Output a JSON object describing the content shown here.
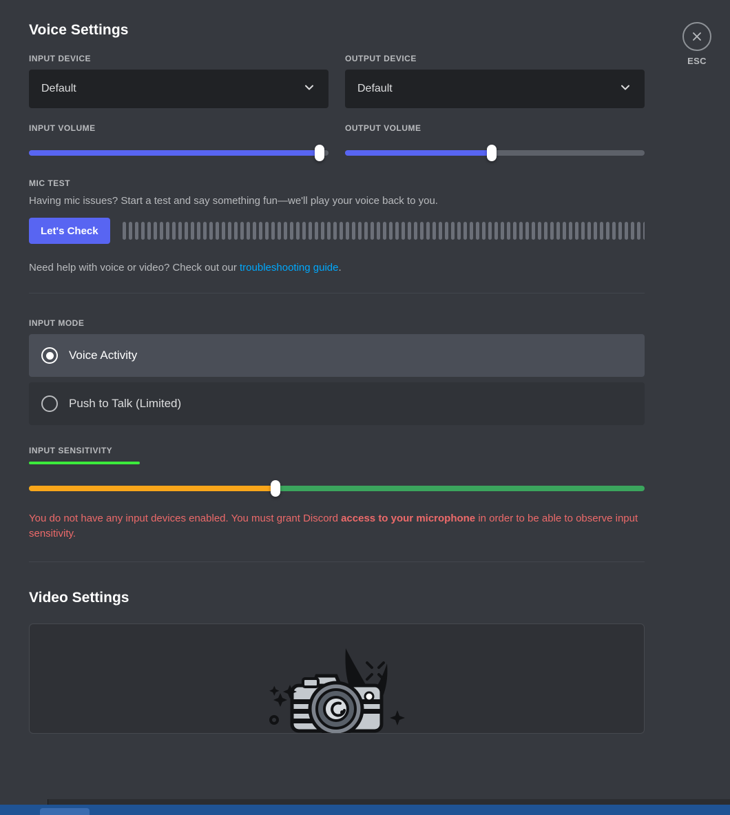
{
  "voice": {
    "title": "Voice Settings",
    "input_device": {
      "label": "INPUT DEVICE",
      "value": "Default",
      "chevron_icon": "chevron-down-icon"
    },
    "output_device": {
      "label": "OUTPUT DEVICE",
      "value": "Default",
      "chevron_icon": "chevron-down-icon"
    },
    "input_volume": {
      "label": "INPUT VOLUME",
      "percent": 97
    },
    "output_volume": {
      "label": "OUTPUT VOLUME",
      "percent": 49
    },
    "mic_test": {
      "label": "MIC TEST",
      "description": "Having mic issues? Start a test and say something fun—we'll play your voice back to you.",
      "button_label": "Let's Check",
      "bar_count": 85
    },
    "help": {
      "prefix": "Need help with voice or video? Check out our ",
      "link_text": "troubleshooting guide",
      "suffix": "."
    },
    "input_mode": {
      "label": "INPUT MODE",
      "options": [
        {
          "label": "Voice Activity",
          "selected": true
        },
        {
          "label": "Push to Talk (Limited)",
          "selected": false
        }
      ]
    },
    "input_sensitivity": {
      "label": "INPUT SENSITIVITY",
      "meter_percent": 18,
      "slider_percent": 40,
      "warning_prefix": "You do not have any input devices enabled. You must grant Discord ",
      "warning_bold": "access to your microphone",
      "warning_suffix": " in order to be able to observe input sensitivity."
    }
  },
  "video": {
    "title": "Video Settings",
    "preview_art_icon": "camera-illustration-icon"
  },
  "close": {
    "icon": "close-icon",
    "label": "ESC"
  },
  "colors": {
    "background": "#36393f",
    "accent_blurple": "#5865f2",
    "select_background": "#202225",
    "slider_track": "#5d6169",
    "sensitivity_low": "#faa61a",
    "sensitivity_high": "#3ba55d",
    "meter_green": "#3ceb3c",
    "warning_red": "#ed6a6a",
    "link_blue": "#00a8fc",
    "muted_text": "#b9bbbe",
    "taskbar_blue": "#1f5394"
  }
}
